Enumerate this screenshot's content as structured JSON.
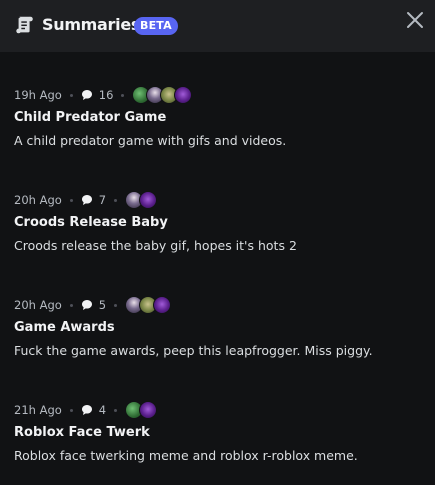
{
  "header": {
    "title": "Summaries",
    "badge": "BETA",
    "icon": "scroll-icon",
    "close_icon": "close-icon"
  },
  "summaries": [
    {
      "time": "19h Ago",
      "comment_count": "16",
      "avatars": [
        "av-green",
        "av-anime",
        "av-frog",
        "av-purple"
      ],
      "title": "Child Predator Game",
      "description": "A child predator game with gifs and videos."
    },
    {
      "time": "20h Ago",
      "comment_count": "7",
      "avatars": [
        "av-anime",
        "av-purple"
      ],
      "title": "Croods Release Baby",
      "description": "Croods release the baby gif, hopes it's hots 2"
    },
    {
      "time": "20h Ago",
      "comment_count": "5",
      "avatars": [
        "av-anime",
        "av-frog",
        "av-purple"
      ],
      "title": "Game Awards",
      "description": "Fuck the game awards, peep this leapfrogger. Miss piggy."
    },
    {
      "time": "21h Ago",
      "comment_count": "4",
      "avatars": [
        "av-green",
        "av-purple"
      ],
      "title": "Roblox Face Twerk",
      "description": "Roblox face twerking meme and roblox r-roblox meme."
    }
  ],
  "colors": {
    "background": "#111214",
    "header": "#1e1f22",
    "badge": "#5865f2",
    "text_primary": "#f2f3f5",
    "text_muted": "#b5bac1"
  }
}
